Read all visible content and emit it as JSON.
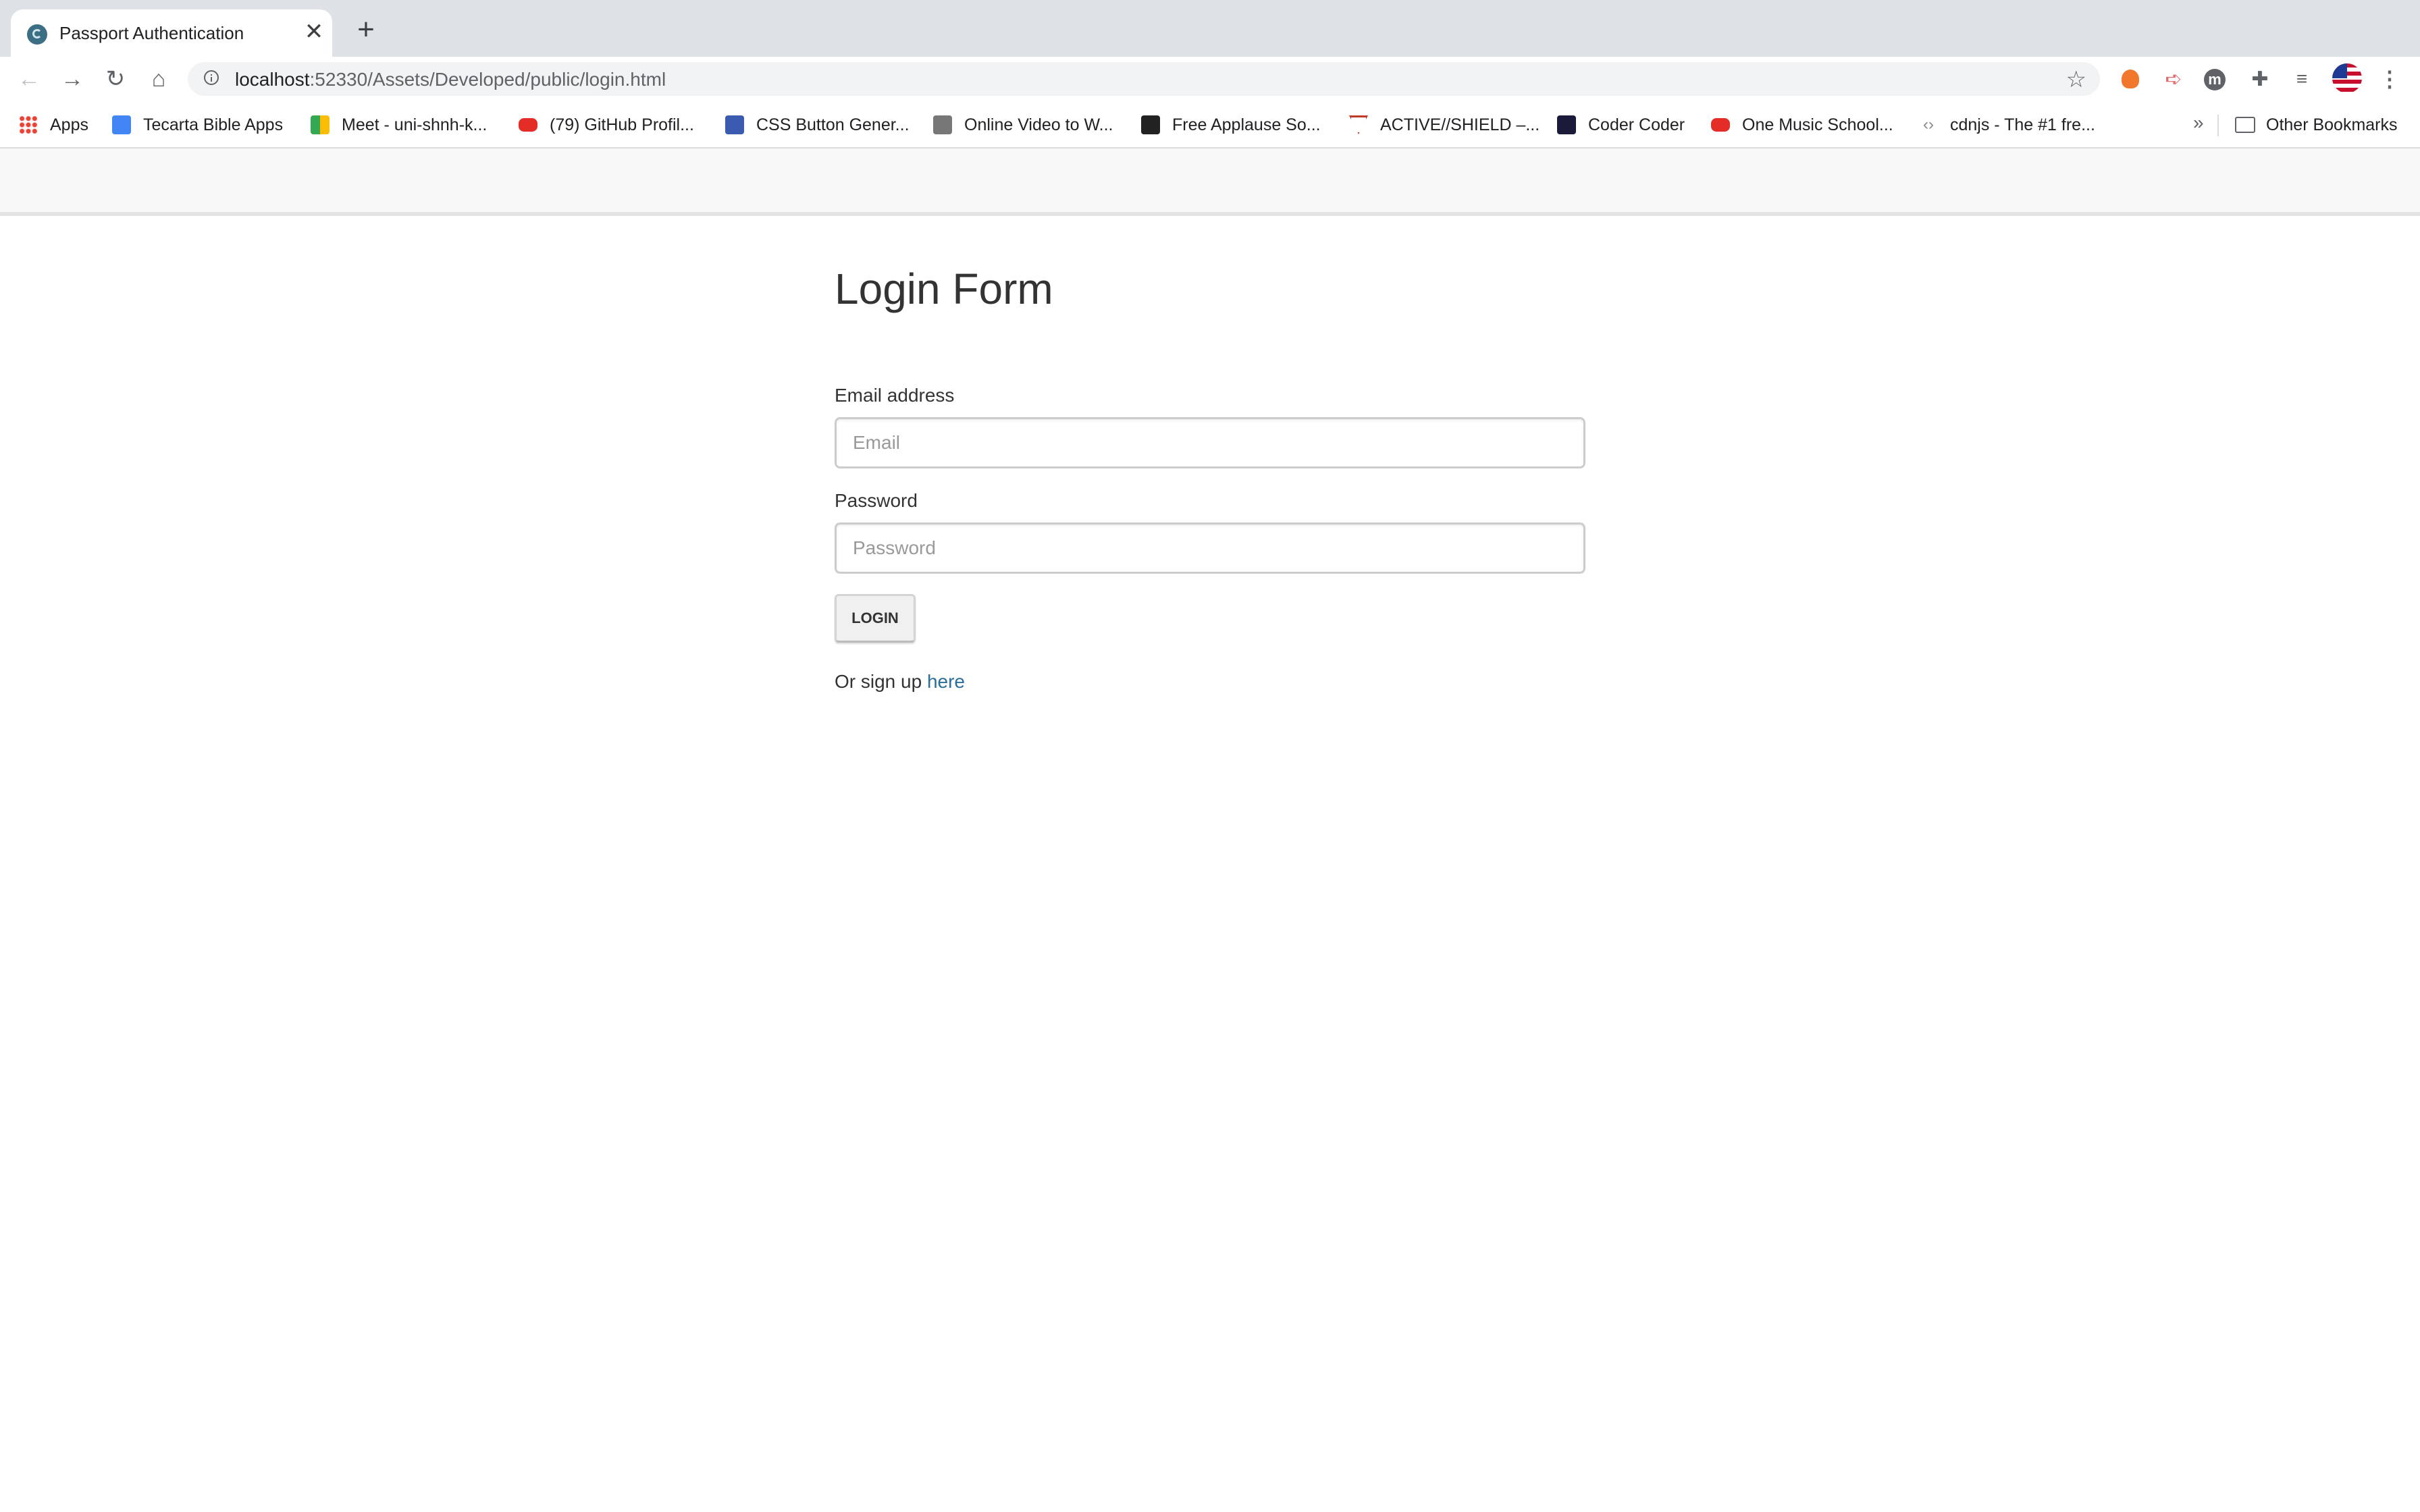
{
  "browser": {
    "tab": {
      "title": "Passport Authentication",
      "close": "✕"
    },
    "new_tab": "+",
    "nav": {
      "back": "←",
      "forward": "→",
      "reload": "↻",
      "home": "⌂"
    },
    "url": {
      "host": "localhost",
      "rest": ":52330/Assets/Developed/public/login.html"
    },
    "star": "☆",
    "extensions": [
      "fire-extension-icon",
      "arrow-extension-icon",
      "m-extension-icon",
      "puzzle-icon",
      "media-queue-icon",
      "us-flag-extension-icon",
      "kebab-menu-icon"
    ],
    "ext_m_letter": "m",
    "ext_arrow": "➪",
    "ext_puzzle": "✚",
    "ext_queue": "≡",
    "menu": "⋮"
  },
  "bookmarks": {
    "items": [
      {
        "label": "Apps",
        "icon": "apps-grid-icon",
        "color": "#ea4335"
      },
      {
        "label": "Tecarta Bible Apps",
        "icon": "tecarta-icon",
        "color": "#4285f4"
      },
      {
        "label": "Meet - uni-shnh-k...",
        "icon": "google-meet-icon",
        "color": "#34a853"
      },
      {
        "label": "(79) GitHub Profil...",
        "icon": "youtube-icon",
        "color": "#e52d27"
      },
      {
        "label": "CSS Button Gener...",
        "icon": "x-icon",
        "color": "#3a5bb0"
      },
      {
        "label": "Online Video to W...",
        "icon": "video-converter-icon",
        "color": "#555555"
      },
      {
        "label": "Free Applause So...",
        "icon": "pir-icon",
        "color": "#222222"
      },
      {
        "label": "ACTIVE//SHIELD –...",
        "icon": "shield-v-icon",
        "color": "#c0392b"
      },
      {
        "label": "Coder Coder",
        "icon": "coder-coder-icon",
        "color": "#1a1a3a"
      },
      {
        "label": "One Music School...",
        "icon": "youtube-icon",
        "color": "#e52d27"
      },
      {
        "label": "cdnjs - The #1 fre...",
        "icon": "code-brackets-icon",
        "color": "#888888"
      }
    ],
    "overflow": "»",
    "other": "Other Bookmarks"
  },
  "page": {
    "title": "Login Form",
    "email_label": "Email address",
    "email_placeholder": "Email",
    "password_label": "Password",
    "password_placeholder": "Password",
    "login_button": "LOGIN",
    "signup_text": "Or sign up",
    "signup_link": "here"
  }
}
